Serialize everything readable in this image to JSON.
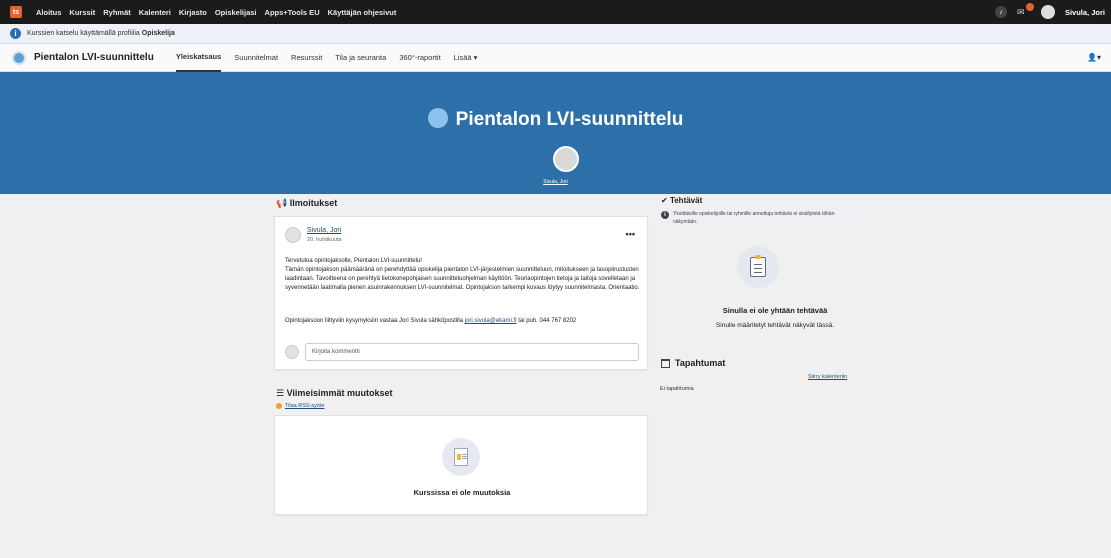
{
  "topnav": {
    "logo": "ts",
    "items": [
      "Aloitus",
      "Kurssit",
      "Ryhmät",
      "Kalenteri",
      "Kirjasto",
      "Opiskelijasi",
      "Apps+Tools EU",
      "Käyttäjän ohjesivut"
    ],
    "user_name": "Sivula, Jori"
  },
  "infobar": {
    "text": "Kurssien katselu käyttämällä profiilia",
    "profile": "Opiskelija"
  },
  "coursenav": {
    "title": "Pientalon LVI-suunnittelu",
    "tabs": [
      "Yleiskatsaus",
      "Suunnitelmat",
      "Resurssit",
      "Tila ja seuranta",
      "360°-raportit",
      "Lisää ▾"
    ],
    "active_tab": "Yleiskatsaus"
  },
  "banner": {
    "title": "Pientalon LVI-suunnittelu",
    "owner": "Sivula, Jori"
  },
  "announcements": {
    "title": "Ilmoitukset",
    "author": "Sivula, Jori",
    "date": "20. huhtikuuta",
    "greeting": "Tervetuloa opintojaksolle, Pientalon LVI-suunnittelu!",
    "body": "Tämän opintojakson päämääränä on perehdyttää opiskelija pientalon LVI-järjestelmien suunnitteluun, mitoitukseen ja tasopiirustusten laadintaan. Tavoitteena on perehtyä tietokonepohjaisen suunnitteluohjelman käyttöön. Teoriaopintojen tietoja ja taitoja sovelletaan ja syvennetään laatimalla pienen asuinrakennuksen LVI-suunnitelmat. Opintojakson tarkempi kuvaus löytyy suunnitelmasta, Orientaatio.",
    "contact_prefix": "Opintojaksoon liittyviin kysymyksiin vastaa Jori Sivula sähköpostilla",
    "contact_email": "jori.sivula@ekami.fi",
    "contact_suffix": "tai puh. 044 767 8202",
    "comment_placeholder": "Kirjoita kommentti"
  },
  "changes": {
    "title": "Viimeisimmät muutokset",
    "rss": "Tilaa RSS-syöte",
    "empty": "Kurssissa ei ole muutoksia"
  },
  "tasks": {
    "title": "Tehtävät",
    "note": "Yksittäisille opiskelijoille tai ryhmille annettuja tehtäviä ei sisällytetä tähän näkymään.",
    "empty": "Sinulla ei ole yhtään tehtävää",
    "sub": "Sinulle määritetyt tehtävät näkyvät tässä."
  },
  "events": {
    "title": "Tapahtumat",
    "calendar_link": "Siirry kalenteriin",
    "empty": "Ei tapahtumia"
  }
}
